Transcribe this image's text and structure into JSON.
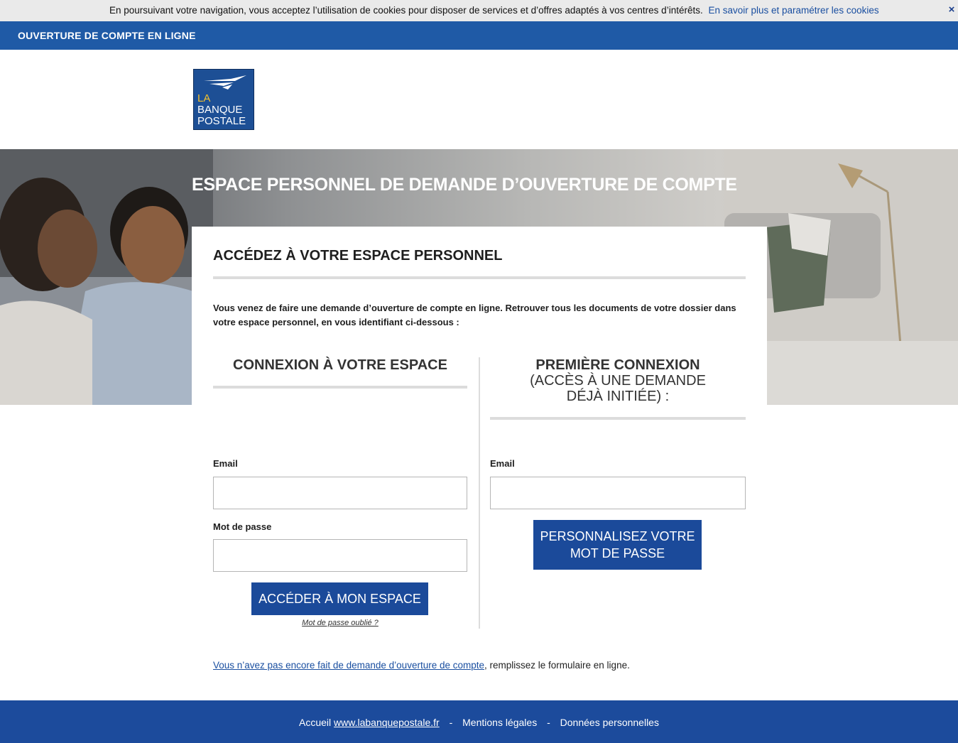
{
  "cookie_bar": {
    "text": "En poursuivant votre navigation, vous acceptez l’utilisation de cookies pour disposer de services et d’offres adaptés à vos centres d’intérêts.",
    "link": "En savoir plus et paramétrer les cookies",
    "close": "×"
  },
  "top_bar": {
    "label": "OUVERTURE DE COMPTE EN LIGNE"
  },
  "logo": {
    "line1": "LA",
    "line2": "BANQUE",
    "line3": "POSTALE"
  },
  "hero": {
    "title": "ESPACE PERSONNEL DE DEMANDE D’OUVERTURE DE COMPTE"
  },
  "card": {
    "title": "ACCÉDEZ À VOTRE ESPACE PERSONNEL",
    "intro": "Vous venez de faire une demande d’ouverture de compte en ligne. Retrouver tous les documents de votre dossier dans votre espace personnel, en vous identifiant ci-dessous :",
    "login": {
      "heading": "CONNEXION À VOTRE ESPACE",
      "email_label": "Email",
      "password_label": "Mot de passe",
      "submit": "ACCÉDER À MON ESPACE",
      "forgot": "Mot de passe oublié ?"
    },
    "first": {
      "heading": "PREMIÈRE CONNEXION",
      "subheading_1": "(ACCÈS À UNE DEMANDE",
      "subheading_2": "DÉJÀ INITIÉE) :",
      "email_label": "Email",
      "submit_1": "PERSONNALISEZ VOTRE",
      "submit_2": "MOT DE PASSE"
    }
  },
  "no_request": {
    "link": "Vous n’avez pas encore fait de demande d’ouverture de compte",
    "rest": ", remplissez le formulaire en ligne."
  },
  "footer": {
    "home_prefix": "Accueil",
    "home_link": "www.labanquepostale.fr",
    "separator": "-",
    "legal": "Mentions légales",
    "personal": "Données personnelles"
  },
  "colors": {
    "brand_blue": "#1f5aa6",
    "button_blue": "#1b4a9a",
    "logo_yellow": "#f3c12c"
  }
}
